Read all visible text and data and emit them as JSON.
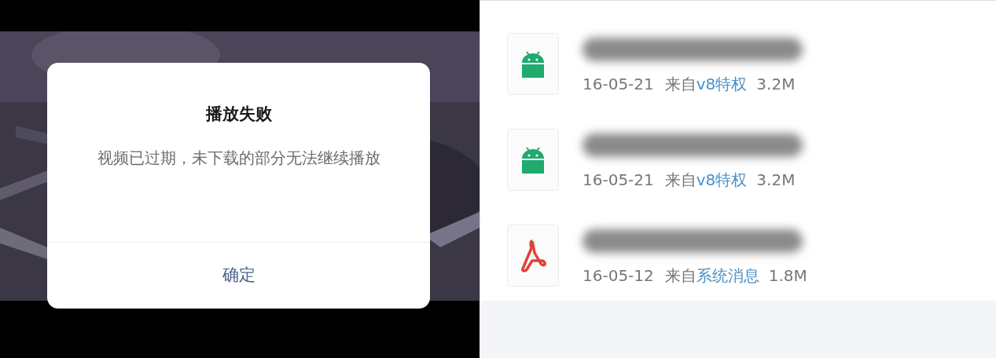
{
  "video_player": {
    "dialog": {
      "title": "播放失败",
      "message": "视频已过期，未下载的部分无法继续播放",
      "button": "确定"
    }
  },
  "file_list": [
    {
      "kind": "android",
      "date": "16-05-21",
      "from_label": "来自",
      "source": "v8特权",
      "size": "3.2M"
    },
    {
      "kind": "android",
      "date": "16-05-21",
      "from_label": "来自",
      "source": "v8特权",
      "size": "3.2M"
    },
    {
      "kind": "pdf",
      "date": "16-05-12",
      "from_label": "来自",
      "source": "系统消息",
      "size": "1.8M"
    }
  ]
}
